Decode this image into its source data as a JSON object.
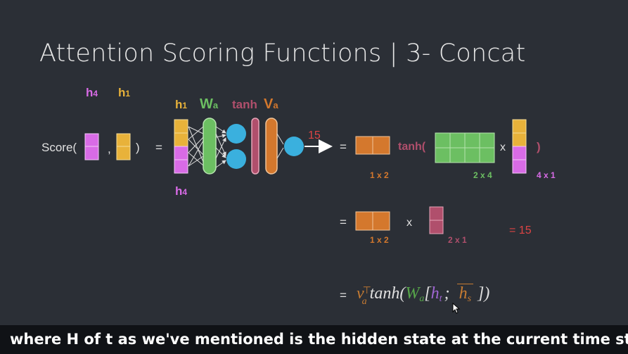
{
  "title": "Attention Scoring Functions | 3- Concat",
  "labels": {
    "h4_top": "h",
    "h4_top_sub": "4",
    "h1_top": "h",
    "h1_top_sub": "1",
    "h1_stack": "h",
    "h1_stack_sub": "1",
    "wa": "W",
    "wa_sub": "a",
    "tanh": "tanh",
    "va": "V",
    "va_sub": "a",
    "h4_bottom": "h",
    "h4_bottom_sub": "4",
    "score_open": "Score(",
    "comma": ",",
    "score_close": ")",
    "equals": "=",
    "output_value": "15",
    "tanh_open": "tanh(",
    "times": "x",
    "close_paren": ")",
    "result": "= 15"
  },
  "dimensions": {
    "row1_a": "1 x 2",
    "row1_b": "2 x 4",
    "row1_c": "4 x 1",
    "row2_a": "1 x 2",
    "row2_b": "2 x 1"
  },
  "formula": {
    "v": "v",
    "v_sub": "a",
    "v_sup": "⊤",
    "tanh": "tanh(",
    "W": "W",
    "W_sub": "a",
    "bracket_open": "[",
    "h_t": "h",
    "h_t_sub": "t",
    "semicolon": ";",
    "h_s": "h",
    "h_s_sub": "s",
    "bracket_close": "])"
  },
  "caption": "where H of t as we've mentioned is the hidden state at the current time step,",
  "colors": {
    "background": "#2b2f36",
    "purple": "#d86be6",
    "yellow": "#e8b23a",
    "green": "#6cbf62",
    "orange": "#d4782d",
    "crimson": "#b04f6c",
    "blue": "#3ab0de",
    "red_text": "#dd4444",
    "formula_orange": "#c67b32",
    "formula_green": "#57a64a",
    "formula_purple": "#a066d3"
  }
}
